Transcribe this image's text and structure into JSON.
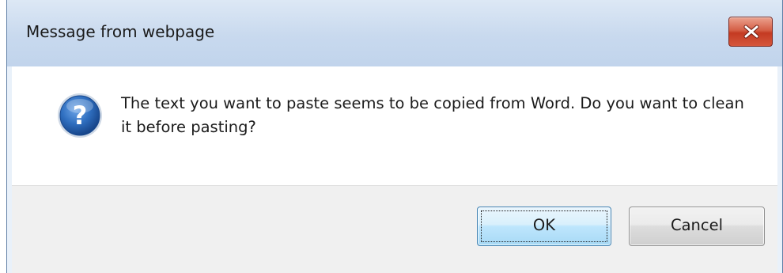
{
  "dialog": {
    "title": "Message from webpage",
    "icon": "question-icon",
    "message": "The text you want to paste seems to be copied from Word. Do you want to clean it before pasting?",
    "buttons": {
      "ok_label": "OK",
      "cancel_label": "Cancel"
    },
    "close_icon": "close-icon"
  },
  "colors": {
    "title_bar": "#c8d9ee",
    "close_button": "#c43a22",
    "ok_button_border": "#3c7fb1",
    "question_icon": "#1f5fa9"
  }
}
